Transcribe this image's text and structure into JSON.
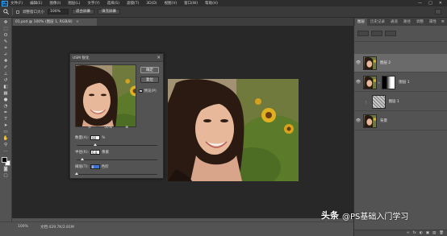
{
  "app": {
    "logo": "Ps",
    "menu": [
      "文件(F)",
      "编辑(E)",
      "图像(I)",
      "图层(L)",
      "文字(Y)",
      "选择(S)",
      "滤镜(T)",
      "3D(D)",
      "视图(V)",
      "窗口(W)",
      "帮助(H)"
    ],
    "window_controls": [
      "—",
      "□",
      "✕"
    ]
  },
  "options_bar": {
    "tool_icon": "zoom-icon",
    "resize_windows_label": "调整窗口大小",
    "zoom_value": "100%",
    "fit_screen_label": "适合屏幕",
    "fill_screen_label": "填充屏幕"
  },
  "document": {
    "tab_title": "01.psd @ 100% (图层 1, RGB/8)",
    "tab_close": "×",
    "status_zoom": "100%",
    "status_doc": "文档:429.7K/2.81M"
  },
  "panel": {
    "tabs": [
      "图层",
      "历史记录",
      "通道",
      "路径",
      "调整",
      "属性"
    ],
    "active_tab": "图层",
    "menu_icon": "≡",
    "layers": [
      {
        "name": "图层 2",
        "visible": true,
        "selected": true,
        "mask": "none"
      },
      {
        "name": "图层 1",
        "visible": true,
        "selected": false,
        "mask": "gradient"
      },
      {
        "name": "图层 1",
        "visible": false,
        "selected": false,
        "mask": "noise"
      },
      {
        "name": "背景",
        "visible": true,
        "selected": false,
        "mask": "none"
      }
    ],
    "bottom_icons": [
      "∞",
      "fx",
      "◐",
      "▣",
      "▤",
      "🗑"
    ]
  },
  "dialog": {
    "title": "USM 锐化",
    "close": "✕",
    "ok_label": "确定",
    "reset_label": "复位",
    "preview_label": "预览(P)",
    "preview_checked": true,
    "zoom_out": "⊖",
    "zoom_value": "50%",
    "zoom_in": "⊕",
    "amount_label": "数量(A):",
    "amount_value": "80",
    "amount_unit": "%",
    "amount_level": 0.23,
    "radius_label": "半径(R):",
    "radius_value": "6.8",
    "radius_unit": "像素",
    "radius_level": 0.07,
    "threshold_label": "阈值(T):",
    "threshold_value": "0",
    "threshold_unit": "色阶",
    "threshold_level": 0.0
  },
  "watermark": {
    "brand": "头条",
    "handle": "@PS基础入门学习"
  },
  "colors": {
    "canvas_bg": "#282828",
    "ui_bg": "#535353",
    "menubar_bg": "#2d2d2d",
    "selected_layer": "#6a6a6a",
    "field_selection": "#3f73c9"
  }
}
